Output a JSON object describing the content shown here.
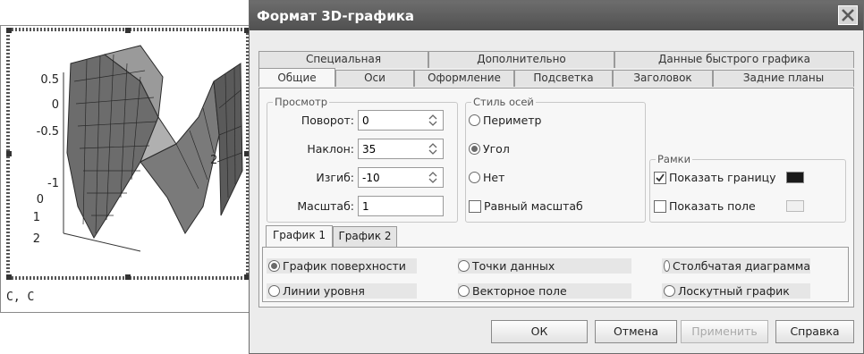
{
  "plot": {
    "caption": "C, C",
    "z_ticks": [
      "0.5",
      "0",
      "-0.5",
      "-1",
      "0",
      "1",
      "2"
    ],
    "x_tick": "2"
  },
  "dialog": {
    "title": "Формат 3D-графика",
    "tabs_row1": [
      "Специальная",
      "Дополнительно",
      "Данные быстрого графика"
    ],
    "tabs_row2": [
      "Общие",
      "Оси",
      "Оформление",
      "Подсветка",
      "Заголовок",
      "Задние планы"
    ],
    "active_tab": "Общие",
    "view": {
      "legend": "Просмотр",
      "rotation_label": "Поворот:",
      "rotation_value": "0",
      "tilt_label": "Наклон:",
      "tilt_value": "35",
      "twist_label": "Изгиб:",
      "twist_value": "-10",
      "scale_label": "Масштаб:",
      "scale_value": "1"
    },
    "axes_style": {
      "legend": "Стиль осей",
      "options": [
        "Периметр",
        "Угол",
        "Нет"
      ],
      "selected": "Угол",
      "equal_scale_label": "Равный масштаб",
      "equal_scale_checked": false
    },
    "frames": {
      "legend": "Рамки",
      "show_border_label": "Показать границу",
      "show_border_checked": true,
      "show_border_color": "#1a1a1a",
      "show_field_label": "Показать поле",
      "show_field_checked": false,
      "show_field_color": "#f0f0f0"
    },
    "subtabs": [
      "График 1",
      "График 2"
    ],
    "active_subtab": "График 1",
    "plot_types": [
      "График поверхности",
      "Точки данных",
      "Столбчатая диаграмма",
      "Линии уровня",
      "Векторное поле",
      "Лоскутный график"
    ],
    "plot_type_selected": "График поверхности",
    "buttons": {
      "ok": "ОК",
      "cancel": "Отмена",
      "apply": "Применить",
      "help": "Справка"
    }
  }
}
